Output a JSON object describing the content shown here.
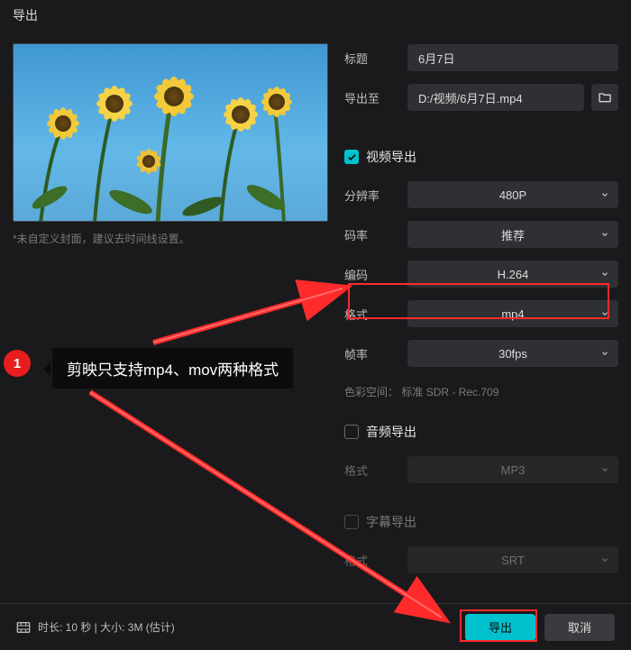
{
  "window": {
    "title": "导出"
  },
  "preview": {
    "hint": "*未自定义封面，建议去时间线设置。"
  },
  "fields": {
    "title_label": "标题",
    "title_value": "6月7日",
    "exportto_label": "导出至",
    "exportto_value": "D:/视频/6月7日.mp4"
  },
  "video": {
    "section": "视频导出",
    "resolution_label": "分辨率",
    "resolution_value": "480P",
    "bitrate_label": "码率",
    "bitrate_value": "推荐",
    "codec_label": "编码",
    "codec_value": "H.264",
    "format_label": "格式",
    "format_value": "mp4",
    "fps_label": "帧率",
    "fps_value": "30fps",
    "colorspace_label": "色彩空间：",
    "colorspace_value": "标准 SDR - Rec.709"
  },
  "audio": {
    "section": "音频导出",
    "format_label": "格式",
    "format_value": "MP3"
  },
  "subtitle": {
    "section": "字幕导出",
    "format_label": "格式",
    "format_value": "SRT"
  },
  "footer": {
    "meta": "时长: 10 秒 | 大小: 3M  (估计)",
    "export": "导出",
    "cancel": "取消"
  },
  "annotation": {
    "num": "1",
    "text": "剪映只支持mp4、mov两种格式"
  }
}
